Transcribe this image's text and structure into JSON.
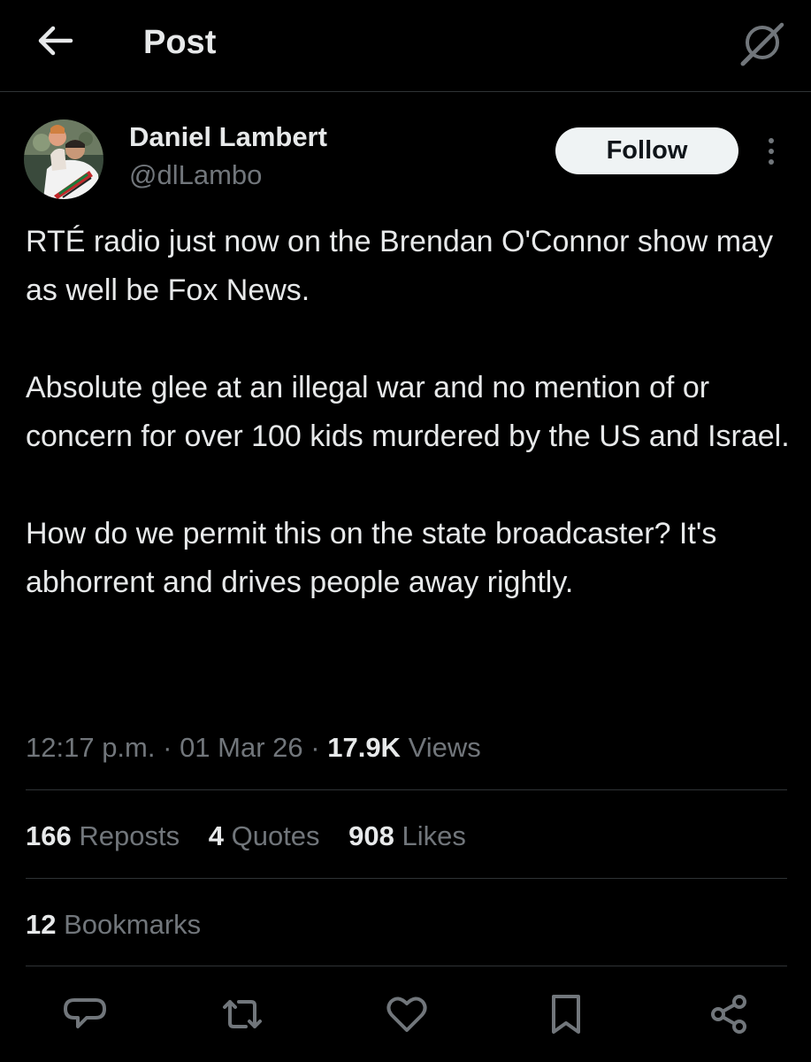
{
  "header": {
    "title": "Post",
    "back_icon": "arrow-left-icon",
    "grok_icon": "grok-icon"
  },
  "author": {
    "display_name": "Daniel Lambert",
    "handle": "@dlLambo",
    "avatar_icon": "avatar-photo"
  },
  "follow_label": "Follow",
  "more_icon": "more-vertical-icon",
  "tweet": {
    "paragraphs": [
      "RTÉ radio just now on the Brendan O'Connor show may as well be Fox News.",
      "Absolute glee at an illegal war and no mention of or concern for over 100 kids murdered by the US and Israel.",
      "How do we permit this on the state broadcaster? It's abhorrent and drives people away rightly."
    ]
  },
  "meta": {
    "time": "12:17 p.m.",
    "separator": "·",
    "date": "01 Mar 26",
    "views_count": "17.9K",
    "views_label": "Views"
  },
  "stats": {
    "reposts": {
      "count": "166",
      "label": "Reposts"
    },
    "quotes": {
      "count": "4",
      "label": "Quotes"
    },
    "likes": {
      "count": "908",
      "label": "Likes"
    },
    "bookmarks": {
      "count": "12",
      "label": "Bookmarks"
    }
  },
  "actions": [
    "reply-icon",
    "repost-icon",
    "like-icon",
    "bookmark-icon",
    "share-icon"
  ],
  "colors": {
    "background": "#000000",
    "primary_text": "#e7e9ea",
    "secondary_text": "#71767b",
    "divider": "#2f3336",
    "follow_bg": "#eff3f4",
    "follow_text": "#0f1419"
  }
}
